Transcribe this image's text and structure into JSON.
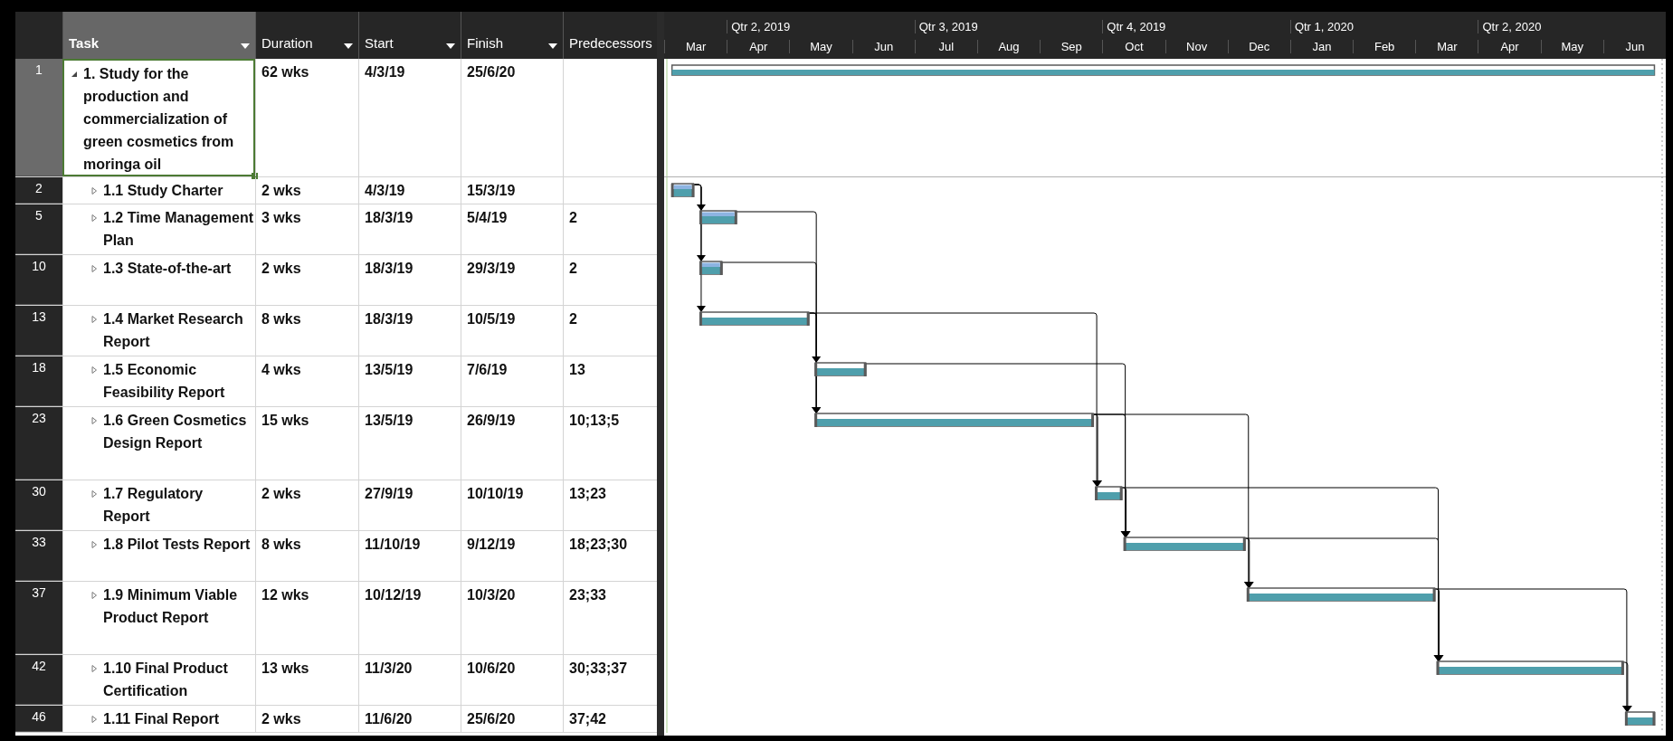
{
  "columns": [
    {
      "label": "Task",
      "selected": true,
      "menu": true
    },
    {
      "label": "Duration",
      "selected": false,
      "menu": true
    },
    {
      "label": "Start",
      "selected": false,
      "menu": true
    },
    {
      "label": "Finish",
      "selected": false,
      "menu": true
    },
    {
      "label": "Predecessors",
      "selected": false,
      "menu": false
    }
  ],
  "timescale": {
    "quarters": [
      "Qtr 2, 2019",
      "Qtr 3, 2019",
      "Qtr 4, 2019",
      "Qtr 1, 2020",
      "Qtr 2, 2020"
    ],
    "months": [
      "Mar",
      "Apr",
      "May",
      "Jun",
      "Jul",
      "Aug",
      "Sep",
      "Oct",
      "Nov",
      "Dec",
      "Jan",
      "Feb",
      "Mar",
      "Apr",
      "May",
      "Jun"
    ]
  },
  "tasks": [
    {
      "id": "1",
      "name": "1. Study for the production and commercialization of green cosmetics from moringa oil",
      "duration": "62 wks",
      "start": "4/3/19",
      "finish": "25/6/20",
      "expanded": true,
      "selected": true,
      "children": [
        {
          "id": "2",
          "name": "1.1 Study Charter",
          "duration": "2 wks",
          "start": "4/3/19",
          "finish": "15/3/19",
          "expanded": false,
          "selected": false,
          "complete": true
        },
        {
          "id": "5",
          "name": "1.2 Time Management Plan",
          "duration": "3 wks",
          "start": "18/3/19",
          "finish": "5/4/19",
          "predecessors": "2",
          "expanded": false,
          "selected": false,
          "complete": true
        },
        {
          "id": "10",
          "name": "1.3 State-of-the-art",
          "duration": "2 wks",
          "start": "18/3/19",
          "finish": "29/3/19",
          "predecessors": "2",
          "expanded": false,
          "selected": false,
          "complete": true
        },
        {
          "id": "13",
          "name": "1.4 Market Research Report",
          "duration": "8 wks",
          "start": "18/3/19",
          "finish": "10/5/19",
          "predecessors": "2",
          "expanded": false,
          "selected": false,
          "complete": false
        },
        {
          "id": "18",
          "name": "1.5 Economic Feasibility Report",
          "duration": "4 wks",
          "start": "13/5/19",
          "finish": "7/6/19",
          "predecessors": "13",
          "expanded": false,
          "selected": false,
          "complete": false
        },
        {
          "id": "23",
          "name": "1.6 Green Cosmetics Design Report",
          "duration": "15 wks",
          "start": "13/5/19",
          "finish": "26/9/19",
          "predecessors": "10;13;5",
          "expanded": false,
          "selected": false,
          "complete": false
        },
        {
          "id": "30",
          "name": "1.7 Regulatory Report",
          "duration": "2 wks",
          "start": "27/9/19",
          "finish": "10/10/19",
          "predecessors": "13;23",
          "expanded": false,
          "selected": false,
          "complete": false
        },
        {
          "id": "33",
          "name": "1.8 Pilot Tests Report",
          "duration": "8 wks",
          "start": "11/10/19",
          "finish": "9/12/19",
          "predecessors": "18;23;30",
          "expanded": false,
          "selected": false,
          "complete": false
        },
        {
          "id": "37",
          "name": "1.9 Minimum Viable Product Report",
          "duration": "12 wks",
          "start": "10/12/19",
          "finish": "10/3/20",
          "predecessors": "23;33",
          "expanded": false,
          "selected": false,
          "complete": false
        },
        {
          "id": "42",
          "name": "1.10 Final Product Certification",
          "duration": "13 wks",
          "start": "11/3/20",
          "finish": "10/6/20",
          "predecessors": "30;33;37",
          "expanded": false,
          "selected": false,
          "complete": false
        },
        {
          "id": "46",
          "name": "1.11 Final Report",
          "duration": "2 wks",
          "start": "11/6/20",
          "finish": "25/6/20",
          "predecessors": "37;42",
          "expanded": false,
          "selected": false,
          "complete": false
        }
      ]
    }
  ]
}
